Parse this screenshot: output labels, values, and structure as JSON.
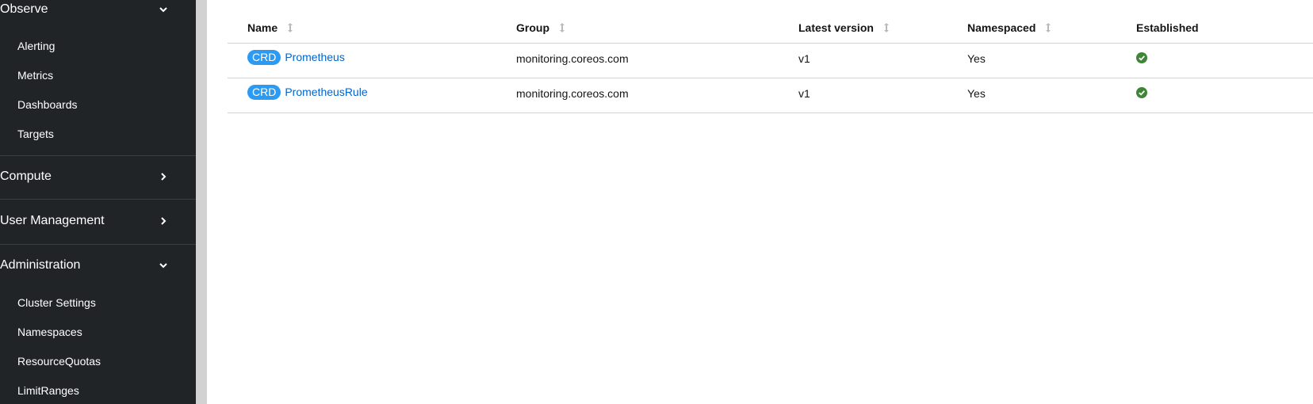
{
  "sidebar": {
    "observe": {
      "label": "Observe",
      "items": [
        "Alerting",
        "Metrics",
        "Dashboards",
        "Targets"
      ]
    },
    "compute": {
      "label": "Compute"
    },
    "user_management": {
      "label": "User Management"
    },
    "administration": {
      "label": "Administration",
      "items": [
        "Cluster Settings",
        "Namespaces",
        "ResourceQuotas",
        "LimitRanges"
      ]
    }
  },
  "table": {
    "columns": [
      "Name",
      "Group",
      "Latest version",
      "Namespaced",
      "Established"
    ],
    "rows": [
      {
        "badge": "CRD",
        "name": "Prometheus",
        "group": "monitoring.coreos.com",
        "version": "v1",
        "namespaced": "Yes",
        "established": "check-circle-icon"
      },
      {
        "badge": "CRD",
        "name": "PrometheusRule",
        "group": "monitoring.coreos.com",
        "version": "v1",
        "namespaced": "Yes",
        "established": "check-circle-icon"
      }
    ]
  },
  "colors": {
    "sidebar_bg": "#212427",
    "link": "#0066cc",
    "badge": "#2b9af3",
    "success": "#3e8635"
  }
}
